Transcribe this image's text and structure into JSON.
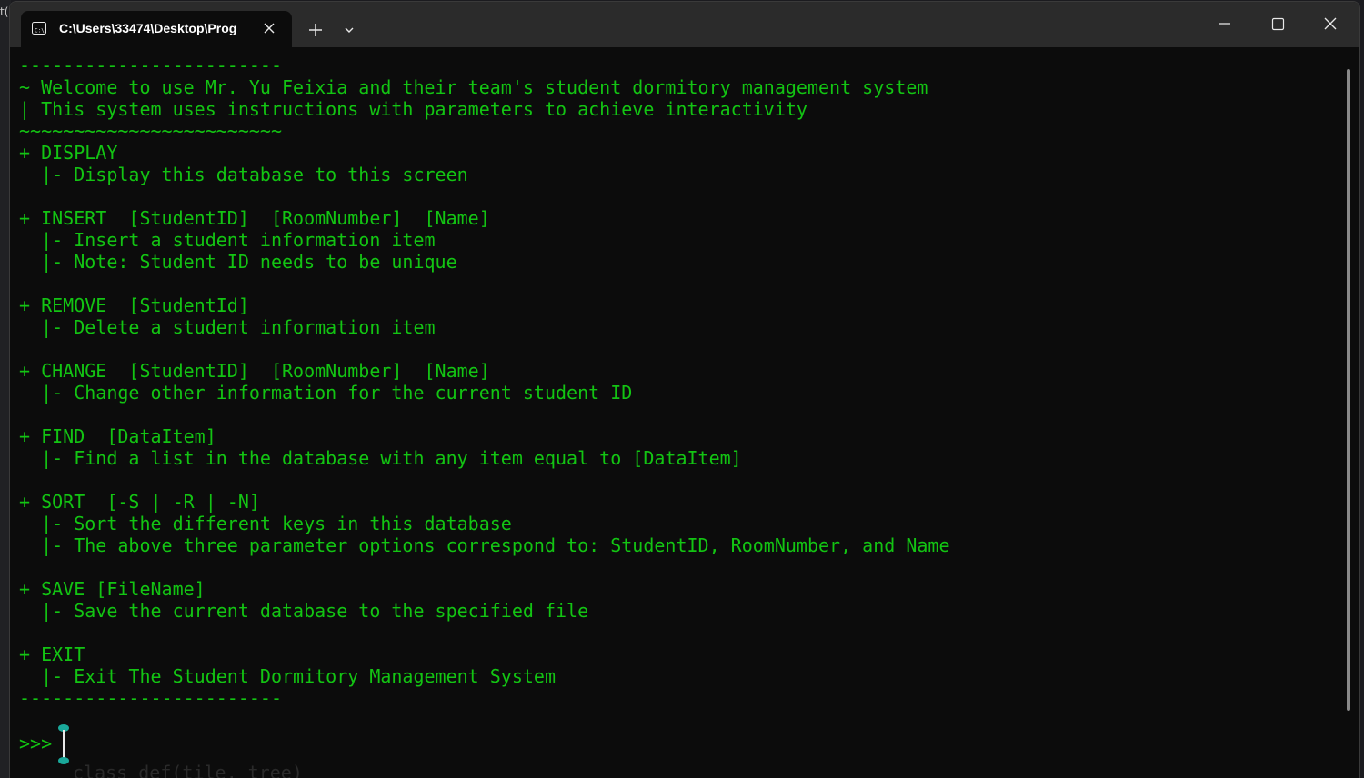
{
  "background": {
    "left_fragment": "t(",
    "ghost_text": "class_def(tile, tree)"
  },
  "window": {
    "tab_title": "C:\\Users\\33474\\Desktop\\Prog",
    "tab_icon": "terminal-icon",
    "new_tab_icon": "plus-icon",
    "dropdown_icon": "chevron-down-icon",
    "controls": [
      "minimize-icon",
      "maximize-icon",
      "close-icon"
    ]
  },
  "terminal": {
    "text_color": "#13c413",
    "background_color": "#0c0c0c",
    "lines": [
      "------------------------",
      "~ Welcome to use Mr. Yu Feixia and their team's student dormitory management system",
      "| This system uses instructions with parameters to achieve interactivity",
      "~~~~~~~~~~~~~~~~~~~~~~~~",
      "+ DISPLAY",
      "  |- Display this database to this screen",
      "",
      "+ INSERT  [StudentID]  [RoomNumber]  [Name]",
      "  |- Insert a student information item",
      "  |- Note: Student ID needs to be unique",
      "",
      "+ REMOVE  [StudentId]",
      "  |- Delete a student information item",
      "",
      "+ CHANGE  [StudentID]  [RoomNumber]  [Name]",
      "  |- Change other information for the current student ID",
      "",
      "+ FIND  [DataItem]",
      "  |- Find a list in the database with any item equal to [DataItem]",
      "",
      "+ SORT  [-S | -R | -N]",
      "  |- Sort the different keys in this database",
      "  |- The above three parameter options correspond to: StudentID, RoomNumber, and Name",
      "",
      "+ SAVE [FileName]",
      "  |- Save the current database to the specified file",
      "",
      "+ EXIT",
      "  |- Exit The Student Dormitory Management System",
      "------------------------"
    ],
    "prompt": ">>>",
    "cursor_icon": "text-cursor-icon"
  }
}
